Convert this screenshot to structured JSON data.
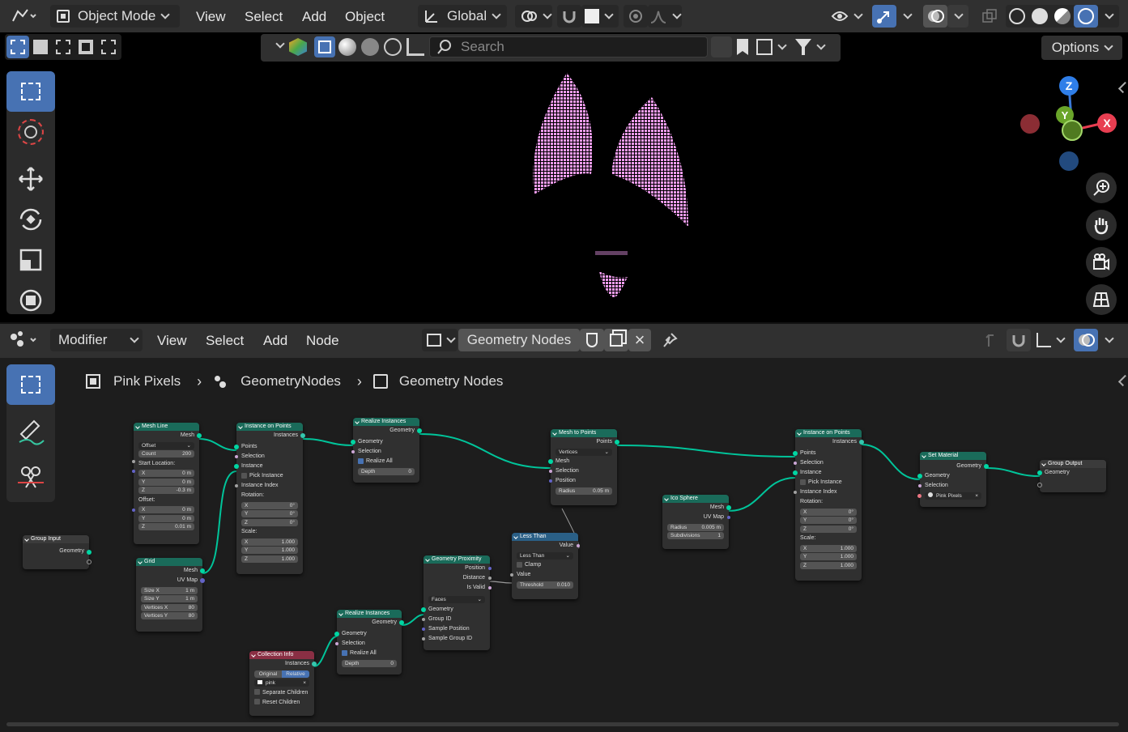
{
  "viewport": {
    "mode_label": "Object Mode",
    "menus": [
      "View",
      "Select",
      "Add",
      "Object"
    ],
    "transform_orientation": "Global",
    "search_placeholder": "Search",
    "options_label": "Options",
    "gizmo": {
      "z": "Z",
      "y": "Y",
      "x": "X"
    }
  },
  "editor": {
    "type_label": "Modifier",
    "menus": [
      "View",
      "Select",
      "Add",
      "Node"
    ],
    "tree_name": "Geometry Nodes",
    "breadcrumb": [
      "Pink Pixels",
      "GeometryNodes",
      "Geometry Nodes"
    ]
  },
  "nodes": {
    "group_input": {
      "title": "Group Input",
      "out": "Geometry"
    },
    "mesh_line": {
      "title": "Mesh Line",
      "out": "Mesh",
      "mode": "Offset",
      "count_label": "Count",
      "count": "200",
      "start_label": "Start Location:",
      "sx": "0 m",
      "sy": "0 m",
      "sz": "-0.3 m",
      "offset_label": "Offset:",
      "ox": "0 m",
      "oy": "0 m",
      "oz": "0.01 m"
    },
    "grid": {
      "title": "Grid",
      "out1": "Mesh",
      "out2": "UV Map",
      "size_x_label": "Size X",
      "size_x": "1 m",
      "size_y_label": "Size Y",
      "size_y": "1 m",
      "vx_label": "Vertices X",
      "vx": "80",
      "vy_label": "Vertices Y",
      "vy": "80"
    },
    "iop1": {
      "title": "Instance on Points",
      "out": "Instances",
      "points": "Points",
      "selection": "Selection",
      "instance": "Instance",
      "pick": "Pick Instance",
      "index": "Instance Index",
      "rotation": "Rotation:",
      "rx": "0°",
      "ry": "0°",
      "rz": "0°",
      "scale": "Scale:",
      "scx": "1.000",
      "scy": "1.000",
      "scz": "1.000"
    },
    "realize1": {
      "title": "Realize Instances",
      "out": "Geometry",
      "geometry": "Geometry",
      "selection": "Selection",
      "realize_all": "Realize All",
      "depth_label": "Depth",
      "depth": "0"
    },
    "mesh_to_points": {
      "title": "Mesh to Points",
      "out": "Points",
      "mode": "Vertices",
      "mesh": "Mesh",
      "selection": "Selection",
      "position": "Position",
      "radius_label": "Radius",
      "radius": "0.05 m"
    },
    "less_than": {
      "title": "Less Than",
      "out": "Value",
      "op": "Less Than",
      "clamp": "Clamp",
      "value": "Value",
      "thr_label": "Threshold",
      "thr": "0.010"
    },
    "proximity": {
      "title": "Geometry Proximity",
      "o1": "Position",
      "o2": "Distance",
      "o3": "Is Valid",
      "mode": "Faces",
      "i1": "Geometry",
      "i2": "Group ID",
      "i3": "Sample Position",
      "i4": "Sample Group ID"
    },
    "realize2": {
      "title": "Realize Instances",
      "out": "Geometry",
      "geometry": "Geometry",
      "selection": "Selection",
      "realize_all": "Realize All",
      "depth_label": "Depth",
      "depth": "0"
    },
    "collection_info": {
      "title": "Collection Info",
      "out": "Instances",
      "opt1": "Original",
      "opt2": "Relative",
      "collection": "pink",
      "sep": "Separate Children",
      "reset": "Reset Children"
    },
    "ico_sphere": {
      "title": "Ico Sphere",
      "out1": "Mesh",
      "out2": "UV Map",
      "radius_label": "Radius",
      "radius": "0.005 m",
      "sub_label": "Subdivisions",
      "sub": "1"
    },
    "iop2": {
      "title": "Instance on Points",
      "out": "Instances",
      "points": "Points",
      "selection": "Selection",
      "instance": "Instance",
      "pick": "Pick Instance",
      "index": "Instance Index",
      "rotation": "Rotation:",
      "rx": "0°",
      "ry": "0°",
      "rz": "0°",
      "scale": "Scale:",
      "scx": "1.000",
      "scy": "1.000",
      "scz": "1.000"
    },
    "set_material": {
      "title": "Set Material",
      "out": "Geometry",
      "geometry": "Geometry",
      "selection": "Selection",
      "material": "Pink Pixels"
    },
    "group_output": {
      "title": "Group Output",
      "in": "Geometry"
    }
  }
}
